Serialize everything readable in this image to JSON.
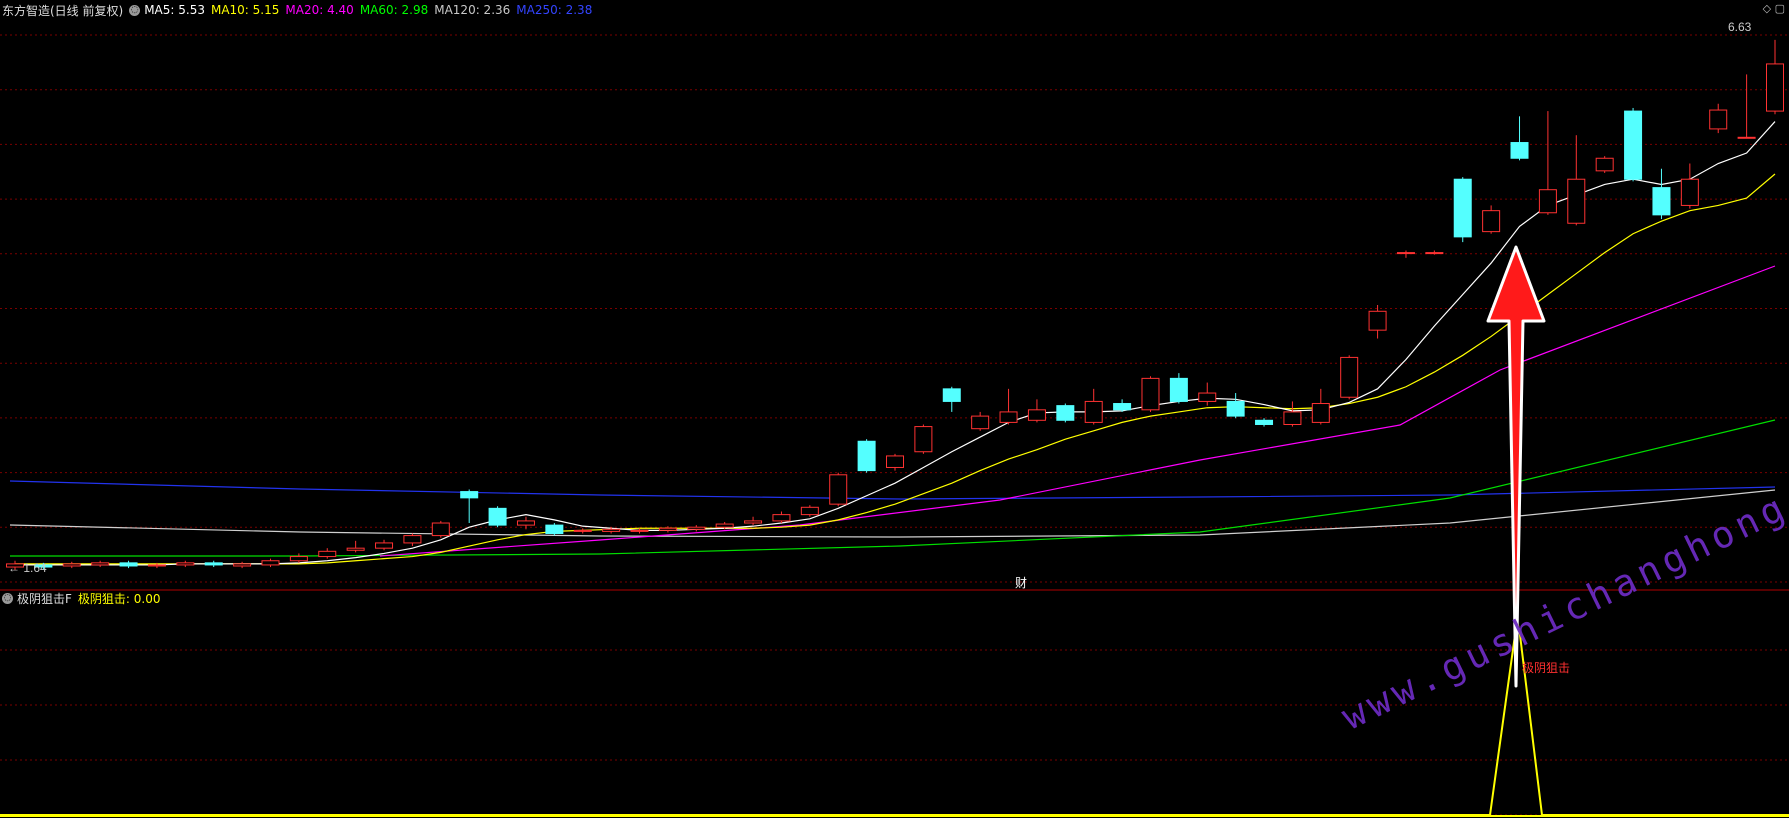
{
  "header": {
    "stock_name": "东方智造(日线 前复权)",
    "ma": [
      {
        "label": "MA5: 5.53",
        "color": "#ffffff"
      },
      {
        "label": "MA10: 5.15",
        "color": "#ffff00"
      },
      {
        "label": "MA20: 4.40",
        "color": "#ff00ff"
      },
      {
        "label": "MA60: 2.98",
        "color": "#00ff00"
      },
      {
        "label": "MA120: 2.36",
        "color": "#c8c8c8"
      },
      {
        "label": "MA250: 2.38",
        "color": "#3344ff"
      }
    ]
  },
  "indicator": {
    "name": "极阴狙击F",
    "value_label": "极阴狙击: 0.00",
    "signal_label": "极阴狙击"
  },
  "markers": {
    "cai": "财"
  },
  "watermark": "www.gushichanghong.com",
  "colors": {
    "up": "#ff3232",
    "down": "#54ffff",
    "grid": "#7a0000",
    "arrow": "#ff1a1a"
  },
  "chart_data": {
    "type": "candlestick",
    "price_max_label": "6.63",
    "price_min_label": "1.64",
    "candles": [
      [
        1.6,
        1.63,
        1.57,
        1.66
      ],
      [
        1.62,
        1.6,
        1.58,
        1.64
      ],
      [
        1.61,
        1.63,
        1.59,
        1.65
      ],
      [
        1.62,
        1.64,
        1.6,
        1.66
      ],
      [
        1.64,
        1.61,
        1.59,
        1.66
      ],
      [
        1.61,
        1.62,
        1.59,
        1.64
      ],
      [
        1.62,
        1.64,
        1.6,
        1.66
      ],
      [
        1.64,
        1.62,
        1.6,
        1.66
      ],
      [
        1.61,
        1.63,
        1.59,
        1.65
      ],
      [
        1.62,
        1.66,
        1.6,
        1.68
      ],
      [
        1.66,
        1.7,
        1.64,
        1.73
      ],
      [
        1.7,
        1.75,
        1.68,
        1.78
      ],
      [
        1.76,
        1.78,
        1.74,
        1.85
      ],
      [
        1.78,
        1.83,
        1.76,
        1.86
      ],
      [
        1.83,
        1.9,
        1.8,
        1.92
      ],
      [
        1.9,
        2.02,
        1.88,
        2.04
      ],
      [
        2.32,
        2.26,
        2.02,
        2.34
      ],
      [
        2.16,
        2.0,
        1.98,
        2.18
      ],
      [
        2.0,
        2.04,
        1.96,
        2.08
      ],
      [
        2.0,
        1.92,
        1.9,
        2.02
      ],
      [
        1.94,
        1.95,
        1.92,
        1.97
      ],
      [
        1.94,
        1.96,
        1.92,
        1.98
      ],
      [
        1.94,
        1.95,
        1.92,
        1.97
      ],
      [
        1.95,
        1.97,
        1.93,
        1.99
      ],
      [
        1.96,
        1.98,
        1.94,
        2.0
      ],
      [
        1.98,
        2.01,
        1.96,
        2.03
      ],
      [
        2.02,
        2.04,
        2.0,
        2.08
      ],
      [
        2.04,
        2.1,
        2.02,
        2.13
      ],
      [
        2.1,
        2.17,
        2.08,
        2.19
      ],
      [
        2.2,
        2.48,
        2.18,
        2.5
      ],
      [
        2.8,
        2.52,
        2.5,
        2.82
      ],
      [
        2.55,
        2.66,
        2.52,
        2.68
      ],
      [
        2.7,
        2.94,
        2.68,
        2.96
      ],
      [
        3.3,
        3.18,
        3.08,
        3.32
      ],
      [
        2.92,
        3.04,
        2.9,
        3.08
      ],
      [
        2.98,
        3.08,
        2.96,
        3.3
      ],
      [
        3.0,
        3.1,
        2.98,
        3.2
      ],
      [
        3.14,
        3.0,
        2.98,
        3.16
      ],
      [
        2.98,
        3.18,
        2.96,
        3.3
      ],
      [
        3.16,
        3.1,
        3.08,
        3.2
      ],
      [
        3.1,
        3.4,
        3.08,
        3.42
      ],
      [
        3.4,
        3.18,
        3.16,
        3.45
      ],
      [
        3.18,
        3.26,
        3.14,
        3.36
      ],
      [
        3.18,
        3.04,
        3.02,
        3.26
      ],
      [
        3.0,
        2.96,
        2.94,
        3.02
      ],
      [
        2.96,
        3.08,
        2.94,
        3.18
      ],
      [
        2.98,
        3.16,
        2.96,
        3.3
      ],
      [
        3.22,
        3.6,
        3.2,
        3.62
      ],
      [
        3.86,
        4.04,
        3.78,
        4.1
      ],
      [
        4.6,
        4.6,
        4.55,
        4.62
      ],
      [
        4.6,
        4.6,
        4.58,
        4.62
      ],
      [
        5.3,
        4.75,
        4.7,
        5.32
      ],
      [
        4.8,
        5.0,
        4.78,
        5.05
      ],
      [
        5.65,
        5.5,
        5.48,
        5.9
      ],
      [
        4.98,
        5.2,
        4.96,
        5.95
      ],
      [
        4.88,
        5.3,
        4.86,
        5.72
      ],
      [
        5.38,
        5.5,
        5.36,
        5.52
      ],
      [
        5.95,
        5.3,
        5.28,
        5.98
      ],
      [
        5.22,
        4.96,
        4.92,
        5.4
      ],
      [
        5.05,
        5.3,
        5.02,
        5.45
      ],
      [
        5.78,
        5.96,
        5.74,
        6.02
      ],
      [
        5.7,
        5.7,
        5.7,
        6.3
      ],
      [
        5.95,
        6.4,
        5.92,
        6.63
      ]
    ],
    "ma_series": {
      "MA5": [
        1.62,
        1.62,
        1.62,
        1.62,
        1.62,
        1.62,
        1.63,
        1.63,
        1.63,
        1.63,
        1.64,
        1.66,
        1.69,
        1.73,
        1.78,
        1.86,
        1.98,
        2.05,
        2.1,
        2.05,
        1.99,
        1.97,
        1.95,
        1.95,
        1.96,
        1.97,
        1.99,
        2.02,
        2.06,
        2.16,
        2.28,
        2.4,
        2.55,
        2.7,
        2.84,
        2.98,
        3.07,
        3.08,
        3.08,
        3.09,
        3.14,
        3.18,
        3.21,
        3.2,
        3.15,
        3.09,
        3.1,
        3.17,
        3.3,
        3.58,
        3.9,
        4.2,
        4.5,
        4.85,
        5.05,
        5.15,
        5.25,
        5.3,
        5.25,
        5.3,
        5.45,
        5.55,
        5.85
      ],
      "MA10": [
        1.63,
        1.63,
        1.63,
        1.63,
        1.63,
        1.63,
        1.63,
        1.63,
        1.63,
        1.63,
        1.63,
        1.64,
        1.66,
        1.68,
        1.7,
        1.74,
        1.8,
        1.86,
        1.91,
        1.94,
        1.95,
        1.96,
        1.97,
        1.97,
        1.97,
        1.97,
        1.97,
        1.98,
        2.0,
        2.05,
        2.12,
        2.2,
        2.3,
        2.4,
        2.52,
        2.63,
        2.72,
        2.82,
        2.9,
        2.98,
        3.04,
        3.08,
        3.12,
        3.13,
        3.12,
        3.11,
        3.12,
        3.16,
        3.22,
        3.32,
        3.46,
        3.62,
        3.8,
        4.0,
        4.2,
        4.4,
        4.6,
        4.78,
        4.9,
        5.0,
        5.05,
        5.12,
        5.35
      ]
    }
  }
}
